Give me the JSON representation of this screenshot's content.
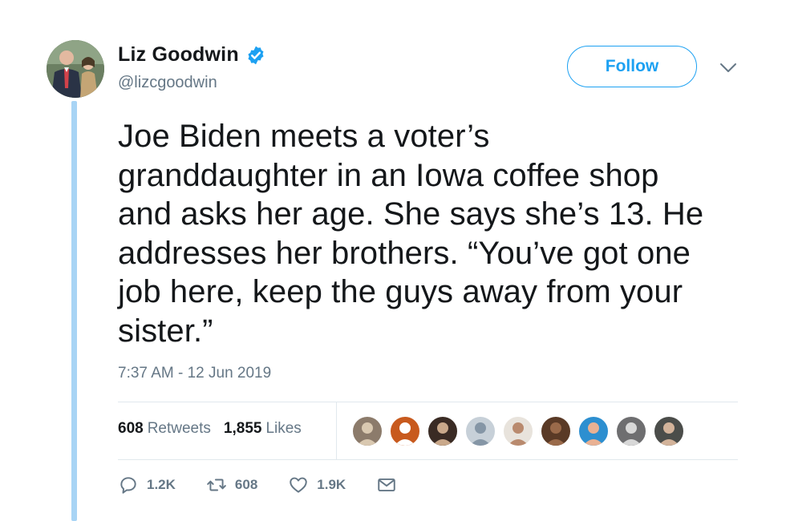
{
  "author": {
    "name": "Liz Goodwin",
    "handle": "@lizcgoodwin",
    "verified": true
  },
  "follow_label": "Follow",
  "tweet": {
    "lines": [
      "Joe Biden meets a voter’s",
      "granddaughter in an Iowa coffee shop",
      "and asks her age. She says she’s 13. He",
      "addresses her brothers. “You’ve got one",
      "job here, keep the guys away from your",
      "sister.”"
    ],
    "timestamp": "7:37 AM - 12 Jun 2019"
  },
  "stats": {
    "retweets_count": "608",
    "retweets_label": "Retweets",
    "likes_count": "1,855",
    "likes_label": "Likes"
  },
  "likers": [
    {
      "icon": "avatar-dog-sketch",
      "bg": "#8c7b6b",
      "fg": "#d9c8b0"
    },
    {
      "icon": "avatar-red-panda",
      "bg": "#c85a1e",
      "fg": "#ffffff"
    },
    {
      "icon": "avatar-person-dark-hair",
      "bg": "#3a2b24",
      "fg": "#c9a88a"
    },
    {
      "icon": "avatar-default-silhouette",
      "bg": "#c7d0d8",
      "fg": "#8596a6"
    },
    {
      "icon": "avatar-person-cap",
      "bg": "#e8e3dc",
      "fg": "#b98a6e"
    },
    {
      "icon": "avatar-brown-dog",
      "bg": "#5a3a26",
      "fg": "#9a6a4a"
    },
    {
      "icon": "avatar-person-blue-bg",
      "bg": "#2d8fd0",
      "fg": "#e9b193"
    },
    {
      "icon": "avatar-figure-grey",
      "bg": "#6e6e70",
      "fg": "#d8d8d8"
    },
    {
      "icon": "avatar-man-beard",
      "bg": "#4b4d4a",
      "fg": "#d3b39a"
    }
  ],
  "actions": {
    "replies": "1.2K",
    "retweets": "608",
    "likes": "1.9K"
  },
  "colors": {
    "brand_blue": "#1da1f2",
    "secondary_text": "#657786",
    "thread_line": "#a8d4f5",
    "divider": "#e1e8ed"
  }
}
